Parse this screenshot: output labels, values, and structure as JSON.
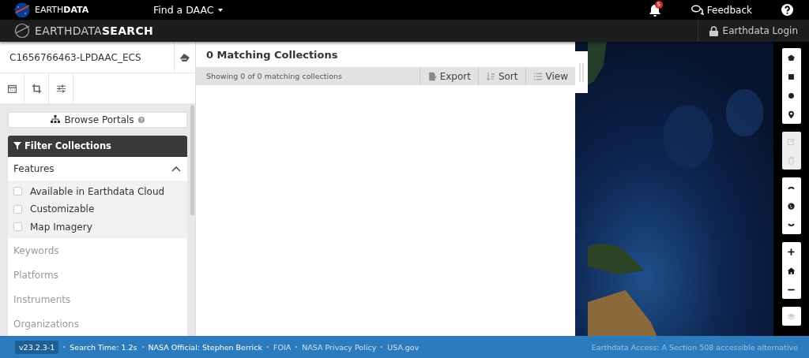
{
  "top_bar": {
    "brand": "EARTH**DATA**",
    "daac_menu": "Find a DAAC",
    "notification_count": "5",
    "feedback": "Feedback"
  },
  "app_bar": {
    "title": "EARTHDATA**SEARCH**",
    "login": "Earthdata Login"
  },
  "sidebar": {
    "search": {
      "value": "C1656766463-LPDAAC_ECS"
    },
    "tools": [
      {
        "kind": "calendar"
      },
      {
        "kind": "crop"
      },
      {
        "kind": "sliders"
      }
    ],
    "browse_portals": "Browse Portals",
    "filter_title": "Filter Collections",
    "features": {
      "title": "Features",
      "expanded": true,
      "options": [
        {
          "label": "Available in Earthdata Cloud",
          "checked": false
        },
        {
          "label": "Customizable",
          "checked": false
        },
        {
          "label": "Map Imagery",
          "checked": false
        }
      ]
    },
    "facets": [
      "Keywords",
      "Platforms",
      "Instruments",
      "Organizations"
    ]
  },
  "results": {
    "title": "0 Matching Collections",
    "summary": "Showing 0 of 0 matching collections",
    "actions": [
      {
        "kind": "export",
        "label": "Export"
      },
      {
        "kind": "sort",
        "label": "Sort"
      },
      {
        "kind": "view",
        "label": "View"
      }
    ]
  },
  "map": {
    "tool_groups": [
      [
        {
          "kind": "polygon",
          "disabled": false
        },
        {
          "kind": "rectangle",
          "disabled": false
        },
        {
          "kind": "circle",
          "disabled": false
        },
        {
          "kind": "pin",
          "disabled": false
        }
      ],
      [
        {
          "kind": "edit",
          "disabled": true
        },
        {
          "kind": "delete",
          "disabled": true
        }
      ],
      [
        {
          "kind": "arctic",
          "disabled": false
        },
        {
          "kind": "globe",
          "disabled": false
        },
        {
          "kind": "antarctic",
          "disabled": false
        }
      ],
      [
        {
          "kind": "zoom-in",
          "disabled": false
        },
        {
          "kind": "home",
          "disabled": false
        },
        {
          "kind": "zoom-out",
          "disabled": false
        }
      ],
      [
        {
          "kind": "layers",
          "disabled": false
        }
      ]
    ]
  },
  "footer": {
    "version": "v23.2.3-1",
    "items": [
      {
        "kind": "info",
        "text": "Search Time: 1.2s"
      },
      {
        "kind": "info",
        "text": "NASA Official: Stephen Berrick"
      },
      {
        "kind": "link",
        "text": "FOIA"
      },
      {
        "kind": "link",
        "text": "NASA Privacy Policy"
      },
      {
        "kind": "link",
        "text": "USA.gov"
      }
    ],
    "accessibility_link": "Earthdata Access: A Section 508 accessible alternative"
  }
}
